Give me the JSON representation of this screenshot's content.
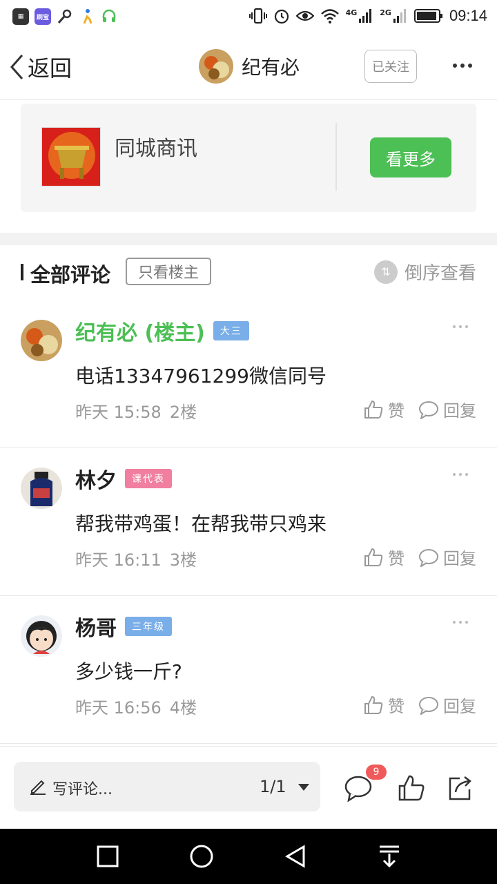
{
  "status_bar": {
    "time": "09:14",
    "signal_4g": "4G",
    "signal_2g": "2G",
    "left_apps": [
      "app-icon-1",
      "app-icon-2",
      "key-icon",
      "app-icon-3",
      "app-icon-4"
    ],
    "left_app_text_2": "刷宝"
  },
  "header": {
    "back_label": "返回",
    "title": "纪有必",
    "follow_label": "已关注"
  },
  "promo": {
    "title": "同城商讯",
    "button_label": "看更多",
    "accent": "#4cbf55"
  },
  "comments_header": {
    "title": "全部评论",
    "filter_label": "只看楼主",
    "sort_label": "倒序查看"
  },
  "comments": [
    {
      "name": "纪有必 (楼主)",
      "badge": "大三",
      "badge_color": "#7aaee8",
      "text": "电话13347961299微信同号",
      "time": "昨天 15:58",
      "floor": "2楼",
      "like_label": "赞",
      "reply_label": "回复"
    },
    {
      "name": "林夕",
      "badge": "课代表",
      "badge_color": "#f07fa0",
      "text": "帮我带鸡蛋！在帮我带只鸡来",
      "time": "昨天 16:11",
      "floor": "3楼",
      "like_label": "赞",
      "reply_label": "回复"
    },
    {
      "name": "杨哥",
      "badge": "三年级",
      "badge_color": "#7aaee8",
      "text": "多少钱一斤?",
      "time": "昨天 16:56",
      "floor": "4楼",
      "like_label": "赞",
      "reply_label": "回复"
    }
  ],
  "bottom_bar": {
    "write_label": "写评论...",
    "page_indicator": "1/1",
    "comment_count": "9"
  }
}
